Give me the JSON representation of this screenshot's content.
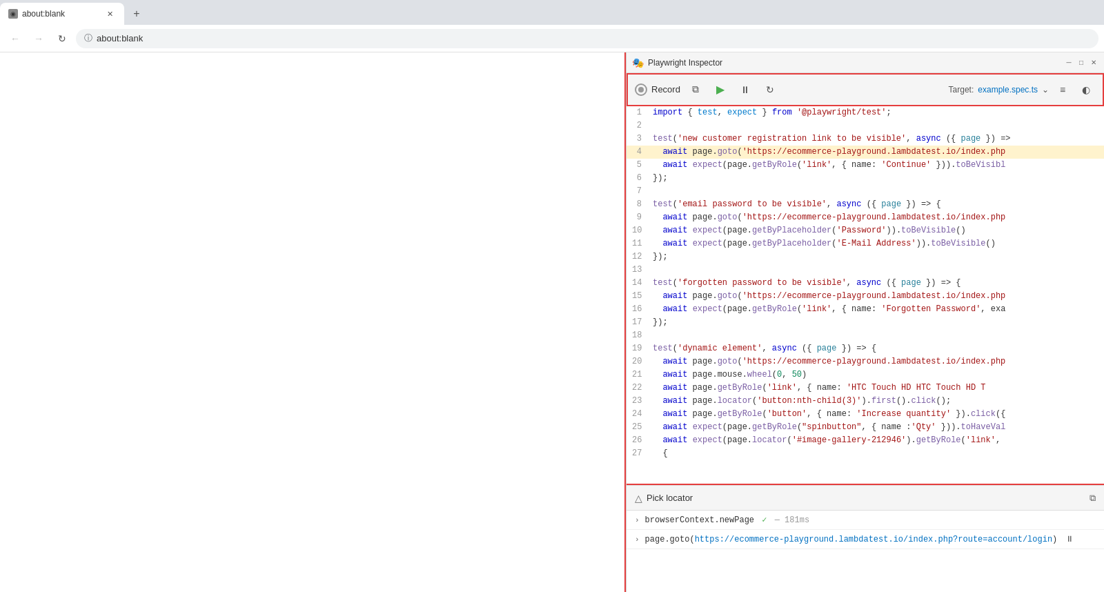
{
  "browser": {
    "tab_title": "about:blank",
    "tab_favicon": "◉",
    "address": "about:blank",
    "address_icon": "🔒"
  },
  "inspector": {
    "title": "Playwright Inspector",
    "title_icon": "🎭",
    "record_label": "Record",
    "target_label": "Target:",
    "target_file": "example.spec.ts",
    "win_min": "─",
    "win_max": "□",
    "win_close": "✕"
  },
  "toolbar": {
    "copy_icon": "⧉",
    "play_icon": "▶",
    "pause_icon": "⏸",
    "refresh_icon": "↻",
    "settings_icon": "≡",
    "dark_mode_icon": "◐"
  },
  "code": {
    "lines": [
      {
        "num": 1,
        "content": "import { test, expect } from '@playwright/test';",
        "highlighted": false
      },
      {
        "num": 2,
        "content": "",
        "highlighted": false
      },
      {
        "num": 3,
        "content": "test('new customer registration link to be visible', async ({ page }) =>",
        "highlighted": false
      },
      {
        "num": 4,
        "content": "  await page.goto('https://ecommerce-playground.lambdatest.io/index.php",
        "highlighted": true
      },
      {
        "num": 5,
        "content": "  await expect(page.getByRole('link', { name: 'Continue' })).toBeVisibl",
        "highlighted": false
      },
      {
        "num": 6,
        "content": "});",
        "highlighted": false
      },
      {
        "num": 7,
        "content": "",
        "highlighted": false
      },
      {
        "num": 8,
        "content": "test('email password to be visible', async ({ page }) => {",
        "highlighted": false
      },
      {
        "num": 9,
        "content": "  await page.goto('https://ecommerce-playground.lambdatest.io/index.php",
        "highlighted": false
      },
      {
        "num": 10,
        "content": "  await expect(page.getByPlaceholder('Password')).toBeVisible()",
        "highlighted": false
      },
      {
        "num": 11,
        "content": "  await expect(page.getByPlaceholder('E-Mail Address')).toBeVisible()",
        "highlighted": false
      },
      {
        "num": 12,
        "content": "});",
        "highlighted": false
      },
      {
        "num": 13,
        "content": "",
        "highlighted": false
      },
      {
        "num": 14,
        "content": "test('forgotten password to be visible', async ({ page }) => {",
        "highlighted": false
      },
      {
        "num": 15,
        "content": "  await page.goto('https://ecommerce-playground.lambdatest.io/index.php",
        "highlighted": false
      },
      {
        "num": 16,
        "content": "  await expect(page.getByRole('link', { name: 'Forgotten Password', exa",
        "highlighted": false
      },
      {
        "num": 17,
        "content": "});",
        "highlighted": false
      },
      {
        "num": 18,
        "content": "",
        "highlighted": false
      },
      {
        "num": 19,
        "content": "test('dynamic element', async ({ page }) => {",
        "highlighted": false
      },
      {
        "num": 20,
        "content": "  await page.goto('https://ecommerce-playground.lambdatest.io/index.php",
        "highlighted": false
      },
      {
        "num": 21,
        "content": "  await page.mouse.wheel(0, 50)",
        "highlighted": false
      },
      {
        "num": 22,
        "content": "  await page.getByRole('link', { name: 'HTC Touch HD HTC Touch HD T",
        "highlighted": false
      },
      {
        "num": 23,
        "content": "  await page.locator('button:nth-child(3)').first().click();",
        "highlighted": false
      },
      {
        "num": 24,
        "content": "  await page.getByRole('button', { name: 'Increase quantity' }).click({",
        "highlighted": false
      },
      {
        "num": 25,
        "content": "  await expect(page.getByRole(\"spinbutton\", { name :'Qty' })).toHaveVal",
        "highlighted": false
      },
      {
        "num": 26,
        "content": "  await expect(page.locator('#image-gallery-212946').getByRole('link', ",
        "highlighted": false
      },
      {
        "num": 27,
        "content": "  {",
        "highlighted": false
      }
    ]
  },
  "bottom": {
    "pick_locator_label": "Pick locator",
    "copy_icon": "⧉",
    "actions": [
      {
        "chevron": "›",
        "method": "browserContext.newPage",
        "checkmark": "✓",
        "separator": "—",
        "time": "181ms",
        "pause": ""
      },
      {
        "chevron": "›",
        "method": "page.goto(",
        "url": "https://ecommerce-playground.lambdatest.io/index.php?route=account/login",
        "closing": ")",
        "pause": "⏸"
      }
    ]
  }
}
